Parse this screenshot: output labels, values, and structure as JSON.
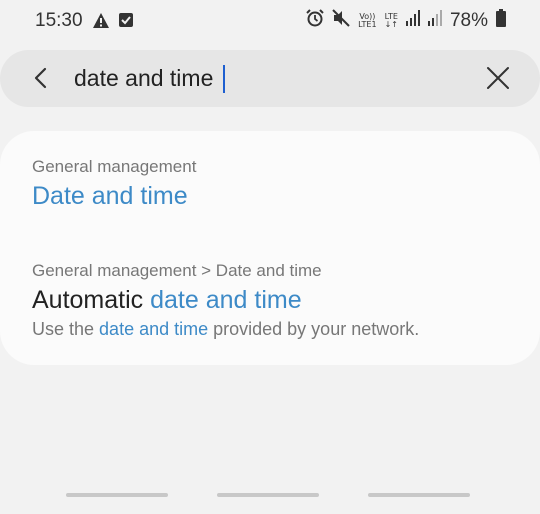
{
  "status_bar": {
    "time": "15:30",
    "left_icons": [
      "warning-icon",
      "checkbox-icon"
    ],
    "right_icons": [
      "alarm-icon",
      "mute-icon",
      "volte-icon",
      "lte-icon",
      "signal-icon",
      "signal-2-icon",
      "battery-icon"
    ],
    "volte_label": "Vo))",
    "volte_sub": "LTE1",
    "lte_label": "LTE",
    "battery": "78%"
  },
  "search": {
    "value": "date and time",
    "back_icon": "back-arrow-icon",
    "clear_icon": "close-icon"
  },
  "results": [
    {
      "breadcrumb": "General management",
      "title_plain": "",
      "title_highlight": "Date and time"
    },
    {
      "breadcrumb": "General management > Date and time",
      "title_plain": "Automatic ",
      "title_highlight": "date and time",
      "desc_before": "Use the ",
      "desc_highlight": "date and time",
      "desc_after": " provided by your network."
    }
  ],
  "colors": {
    "highlight": "#3d8ac7",
    "background": "#f2f2f2",
    "card": "#fbfbfb",
    "search_bg": "#e6e6e6",
    "caret": "#1e5fd0"
  },
  "nav_bar": [
    "recent-apps",
    "home",
    "back"
  ]
}
